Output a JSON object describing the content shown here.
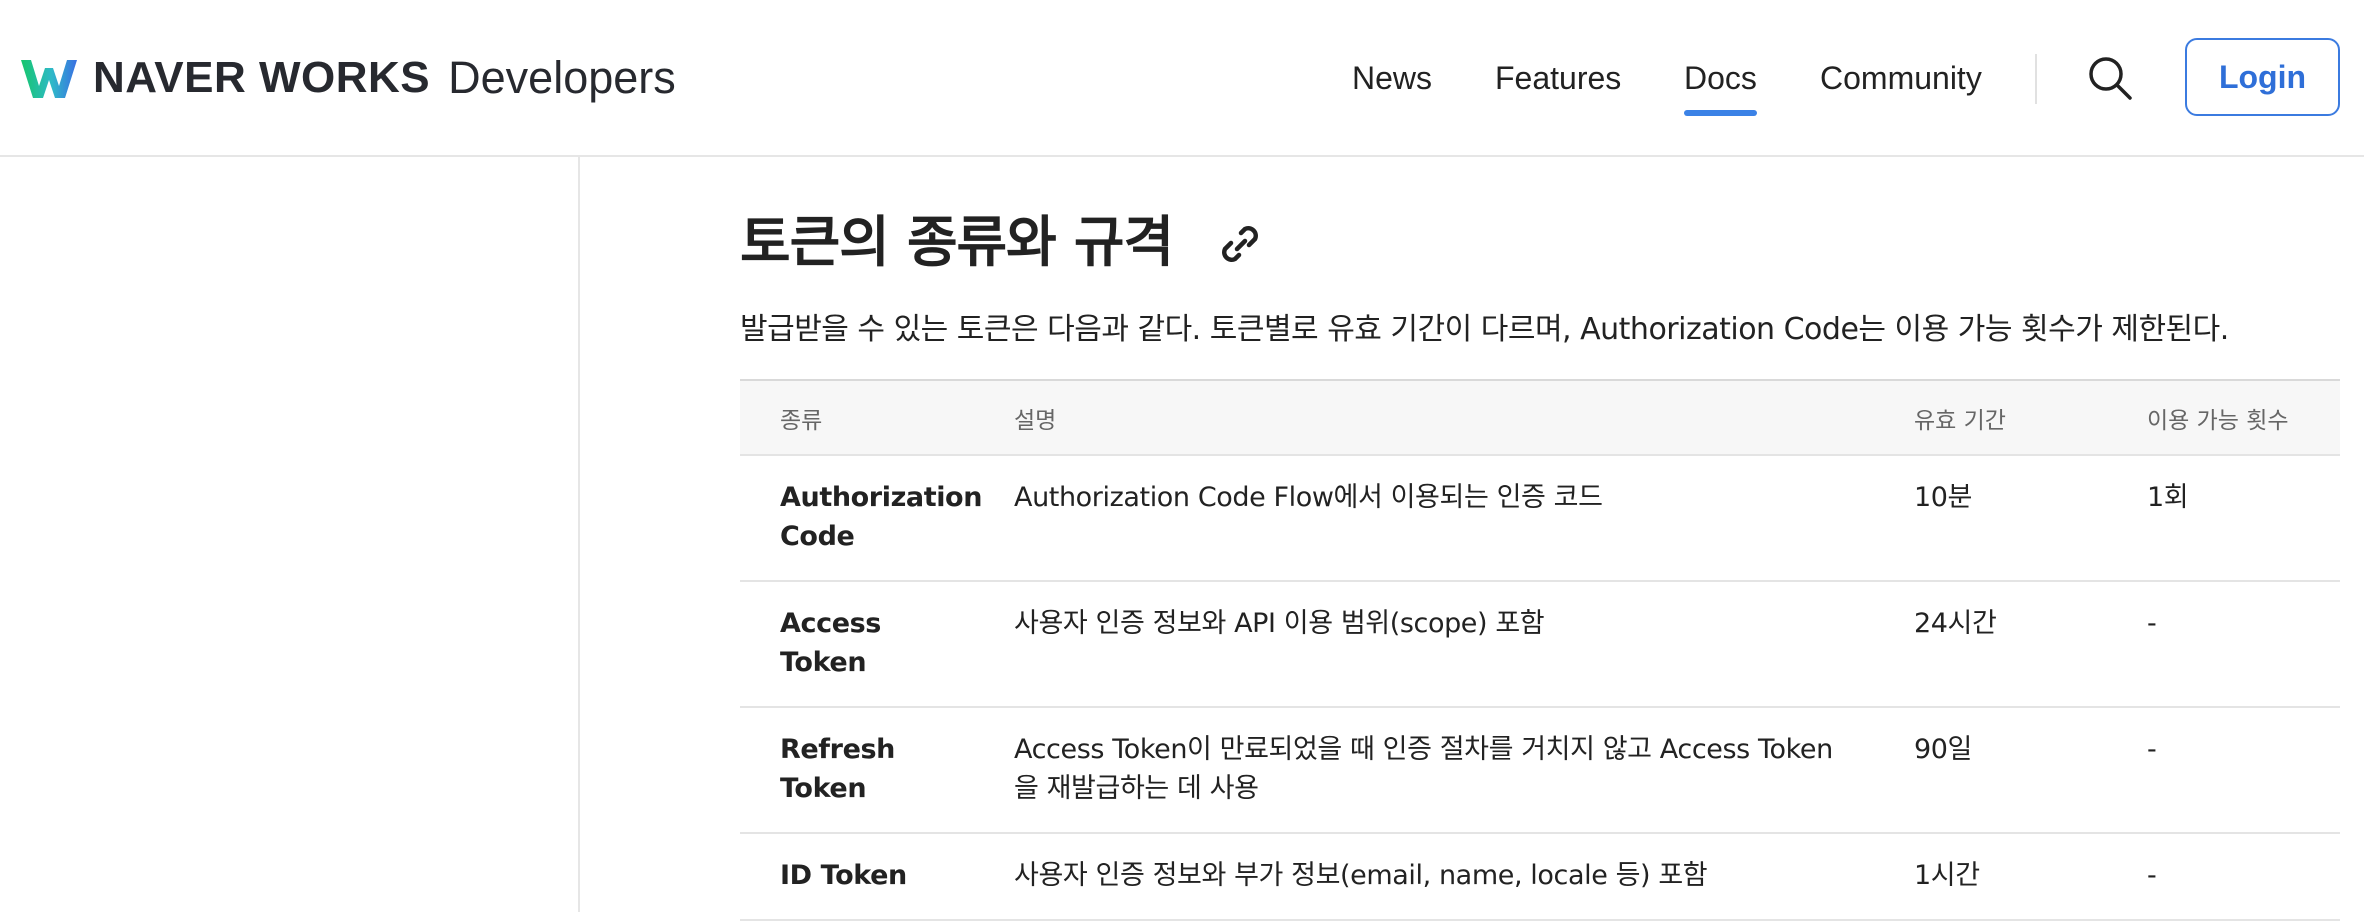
{
  "header": {
    "brand": "NAVER WORKS",
    "brand_sub": "Developers",
    "nav": [
      {
        "label": "News"
      },
      {
        "label": "Features"
      },
      {
        "label": "Docs",
        "active": true
      },
      {
        "label": "Community"
      }
    ],
    "search_icon": "search-icon",
    "login_label": "Login"
  },
  "colors": {
    "accent": "#3b82e6",
    "login_border": "#3b7be0",
    "text": "#222222",
    "header_cell_bg": "#f7f7f7"
  },
  "content": {
    "title": "토큰의 종류와 규격",
    "title_link_icon": "link-icon",
    "intro": "발급받을 수 있는 토큰은 다음과 같다. 토큰별로 유효 기간이 다르며, Authorization Code는 이용 가능 횟수가 제한된다.",
    "table": {
      "headers": [
        "종류",
        "설명",
        "유효 기간",
        "이용 가능 횟수"
      ],
      "rows": [
        {
          "type": "Authorization Code",
          "description": "Authorization Code Flow에서 이용되는 인증 코드",
          "validity": "10분",
          "count": "1회"
        },
        {
          "type": "Access Token",
          "description": "사용자 인증 정보와 API 이용 범위(scope) 포함",
          "validity": "24시간",
          "count": "-"
        },
        {
          "type": "Refresh Token",
          "description": "Access Token이 만료되었을 때 인증 절차를 거치지 않고 Access Token을 재발급하는 데 사용",
          "validity": "90일",
          "count": "-"
        },
        {
          "type": "ID Token",
          "description": "사용자 인증 정보와 부가 정보(email, name, locale 등) 포함",
          "validity": "1시간",
          "count": "-"
        }
      ]
    }
  }
}
